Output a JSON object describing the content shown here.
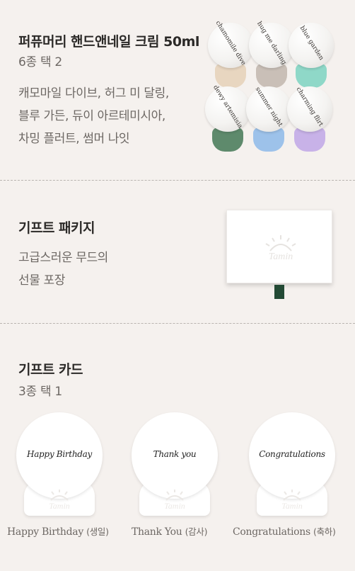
{
  "section1": {
    "title": "퍼퓨머리 핸드앤네일 크림 50ml",
    "subtitle": "6종 택 2",
    "desc_lines": [
      "캐모마일 다이브, 허그 미 달링,",
      "블루 가든, 듀이 아르테미시아,",
      "차밍 플러트, 썸머 나잇"
    ],
    "tubes": [
      {
        "label": "chamomile dive",
        "cap_color": "#e8d6c0"
      },
      {
        "label": "hug me darling",
        "cap_color": "#c9bfb7"
      },
      {
        "label": "blue garden",
        "cap_color": "#8fd8c8"
      },
      {
        "label": "dewy artemisia",
        "cap_color": "#5e8a6c"
      },
      {
        "label": "summer night",
        "cap_color": "#9dc2ea"
      },
      {
        "label": "charming flirt",
        "cap_color": "#c8b2e8"
      }
    ]
  },
  "section2": {
    "title": "기프트 패키지",
    "desc_lines": [
      "고급스러운 무드의",
      "선물 포장"
    ],
    "ribbon_color": "#234a35"
  },
  "section3": {
    "title": "기프트 카드",
    "subtitle": "3종 택 1",
    "cards": [
      {
        "message": "Happy Birthday",
        "caption_en": "Happy Birthday",
        "caption_ko": "(생일)"
      },
      {
        "message": "Thank you",
        "caption_en": "Thank You",
        "caption_ko": "(감사)"
      },
      {
        "message": "Congratulations",
        "caption_en": "Congratulations",
        "caption_ko": "(축하)"
      }
    ]
  }
}
